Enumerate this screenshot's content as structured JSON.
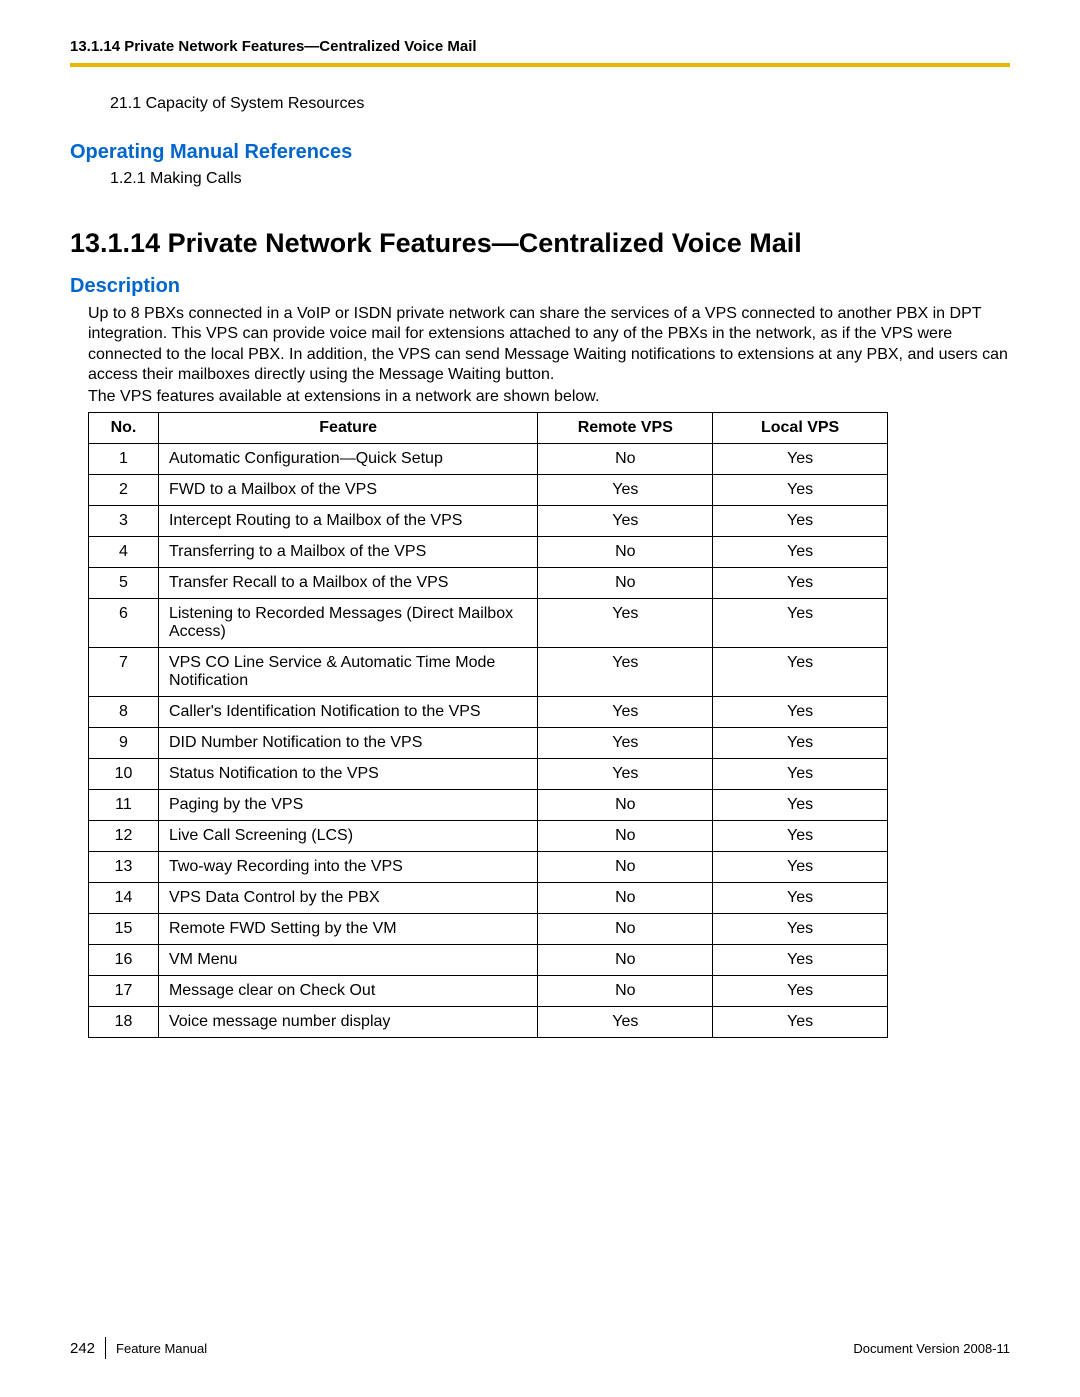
{
  "header": {
    "running_title": "13.1.14 Private Network Features—Centralized Voice Mail"
  },
  "refs": {
    "item1": "21.1  Capacity of System Resources",
    "section_sub": "Operating Manual References",
    "item2": "1.2.1  Making Calls"
  },
  "main": {
    "heading": "13.1.14  Private Network Features—Centralized Voice Mail",
    "description_label": "Description",
    "description_body": "Up to 8 PBXs connected in a VoIP or ISDN private network can share the services of a VPS connected to another PBX in DPT integration. This VPS can provide voice mail for extensions attached to any of the PBXs in the network, as if the VPS were connected to the local PBX. In addition, the VPS can send Message Waiting notifications to extensions at any PBX, and users can access their mailboxes directly using the Message Waiting button.",
    "table_lead": "The VPS features available at extensions in a network are shown below."
  },
  "table": {
    "headers": {
      "no": "No.",
      "feature": "Feature",
      "remote": "Remote VPS",
      "local": "Local VPS"
    },
    "rows": [
      {
        "no": "1",
        "feature": "Automatic Configuration—Quick Setup",
        "remote": "No",
        "local": "Yes"
      },
      {
        "no": "2",
        "feature": "FWD to a Mailbox of the VPS",
        "remote": "Yes",
        "local": "Yes"
      },
      {
        "no": "3",
        "feature": "Intercept Routing to a Mailbox of the VPS",
        "remote": "Yes",
        "local": "Yes"
      },
      {
        "no": "4",
        "feature": "Transferring to a Mailbox of the VPS",
        "remote": "No",
        "local": "Yes"
      },
      {
        "no": "5",
        "feature": "Transfer Recall to a Mailbox of the VPS",
        "remote": "No",
        "local": "Yes"
      },
      {
        "no": "6",
        "feature": "Listening to Recorded Messages (Direct Mailbox Access)",
        "remote": "Yes",
        "local": "Yes"
      },
      {
        "no": "7",
        "feature": "VPS CO Line Service & Automatic Time Mode Notification",
        "remote": "Yes",
        "local": "Yes"
      },
      {
        "no": "8",
        "feature": "Caller's Identification Notification to the VPS",
        "remote": "Yes",
        "local": "Yes"
      },
      {
        "no": "9",
        "feature": "DID Number Notification to the VPS",
        "remote": "Yes",
        "local": "Yes"
      },
      {
        "no": "10",
        "feature": "Status Notification to the VPS",
        "remote": "Yes",
        "local": "Yes"
      },
      {
        "no": "11",
        "feature": "Paging by the VPS",
        "remote": "No",
        "local": "Yes"
      },
      {
        "no": "12",
        "feature": "Live Call Screening (LCS)",
        "remote": "No",
        "local": "Yes"
      },
      {
        "no": "13",
        "feature": "Two-way Recording into the VPS",
        "remote": "No",
        "local": "Yes"
      },
      {
        "no": "14",
        "feature": "VPS Data Control by the PBX",
        "remote": "No",
        "local": "Yes"
      },
      {
        "no": "15",
        "feature": "Remote FWD Setting by the VM",
        "remote": "No",
        "local": "Yes"
      },
      {
        "no": "16",
        "feature": "VM Menu",
        "remote": "No",
        "local": "Yes"
      },
      {
        "no": "17",
        "feature": "Message clear on Check Out",
        "remote": "No",
        "local": "Yes"
      },
      {
        "no": "18",
        "feature": "Voice message number display",
        "remote": "Yes",
        "local": "Yes"
      }
    ]
  },
  "footer": {
    "page_no": "242",
    "manual": "Feature Manual",
    "version": "Document Version  2008-11"
  }
}
